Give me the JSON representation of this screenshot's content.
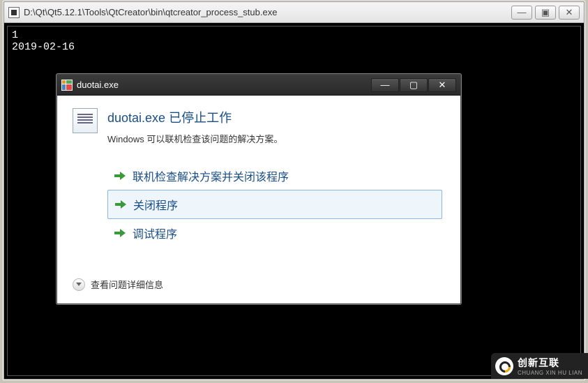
{
  "outer": {
    "title": "D:\\Qt\\Qt5.12.1\\Tools\\QtCreator\\bin\\qtcreator_process_stub.exe",
    "btn_min": "—",
    "btn_max": "▣",
    "btn_close": "✕"
  },
  "console": {
    "lines": [
      "1",
      "2019-02-16"
    ]
  },
  "dialog": {
    "title": "duotai.exe",
    "btn_min": "—",
    "btn_max": "▢",
    "btn_close": "✕",
    "heading": "duotai.exe 已停止工作",
    "subheading": "Windows 可以联机检查该问题的解决方案。",
    "options": [
      {
        "label": "联机检查解决方案并关闭该程序",
        "selected": false
      },
      {
        "label": "关闭程序",
        "selected": true
      },
      {
        "label": "调试程序",
        "selected": false
      }
    ],
    "details": "查看问题详细信息"
  },
  "watermark": {
    "cn": "创新互联",
    "en": "CHUANG XIN HU LIAN"
  }
}
